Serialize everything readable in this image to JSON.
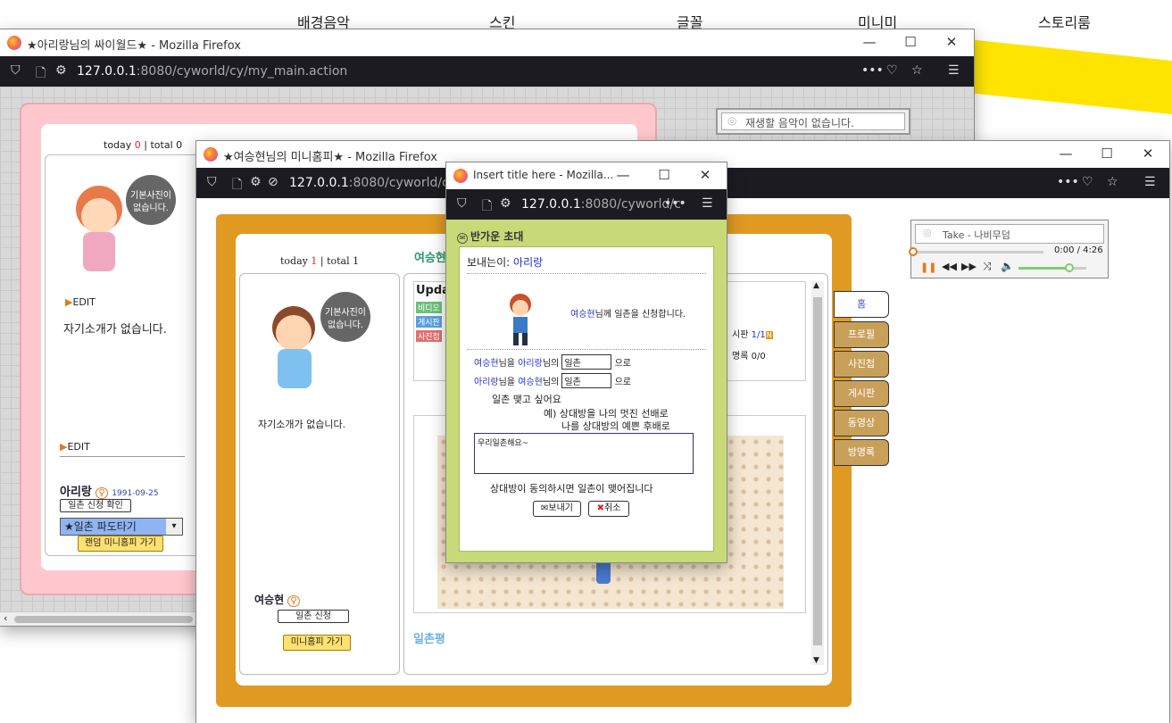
{
  "topnav": {
    "items": [
      "배경음악",
      "스킨",
      "글꼴",
      "미니미",
      "스토리룸"
    ]
  },
  "win1": {
    "title": "★아리랑님의 싸이월드★ - Mozilla Firefox",
    "url_host": "127.0.0.1",
    "url_rest": ":8080/cyworld/cy/my_main.action",
    "today_label": "today",
    "today": "0",
    "total_label": "total",
    "total": "0",
    "speech": "기본사진이 없습니다.",
    "edit": "EDIT",
    "intro": "자기소개가 없습니다.",
    "edit2": "EDIT",
    "name": "아리랑",
    "birth": "1991-09-25",
    "ilchon_confirm": "일촌 신청 확인",
    "select_value": "★일촌 파도타기",
    "random_btn": "랜덤 미니홈피 가기",
    "music": "재생할 음악이 없습니다."
  },
  "win2": {
    "title": "★여승현님의 미니홈피★ - Mozilla Firefox",
    "url_host": "127.0.0.1",
    "url_rest": ":8080/cyworld/cy/u",
    "today_label": "today",
    "today": "1",
    "total_label": "total",
    "total": "1",
    "owner_title": "여승현",
    "speech": "기본사진이 없습니다.",
    "intro": "자기소개가 없습니다.",
    "name": "여승현",
    "ilchon_btn": "일촌 신청",
    "go_btn": "미니홈피 가기",
    "updated": "Upda",
    "badges": [
      "비디오",
      "게시판",
      "사진첩"
    ],
    "board_count_label": "시판",
    "board_count": "1/1",
    "guest_label": "명록",
    "guest_count": "0/0",
    "ilchon_comment": "일촌평",
    "tabs": [
      "홈",
      "프로필",
      "사진첩",
      "게시판",
      "동영상",
      "방명록"
    ],
    "player_track": "Take - 나비무덤",
    "player_time": "0:00 / 4:26",
    "player_progress": 0.0,
    "player_volume": 0.75
  },
  "popup": {
    "title": "Insert title here - Mozilla...",
    "url_host": "127.0.0.1",
    "url_rest": ":8080/cyworld/c",
    "header": "반가운 초대",
    "sender_label": "보내는이:",
    "sender": "아리랑",
    "target": "여승현",
    "request_text": "님께 일촌을 신청합니다.",
    "row1_a": "여승현",
    "row1_mid": "님을",
    "row1_b": "아리랑",
    "row1_suffix": "님의",
    "row1_value": "일촌",
    "row1_end": "으로",
    "row2_a": "아리랑",
    "row2_mid": "님을",
    "row2_b": "여승현",
    "row2_suffix": "님의",
    "row2_value": "일촌",
    "row2_end": "으로",
    "desc": "일촌 맺고 싶어요",
    "example1": "예) 상대방을 나의 멋진 선배로",
    "example2": "나를 상대방의 예쁜 후배로",
    "message": "우리일촌해요~",
    "notice": "상대방이 동의하시면 일촌이 맺어집니다",
    "send": "보내기",
    "cancel": "취소"
  }
}
